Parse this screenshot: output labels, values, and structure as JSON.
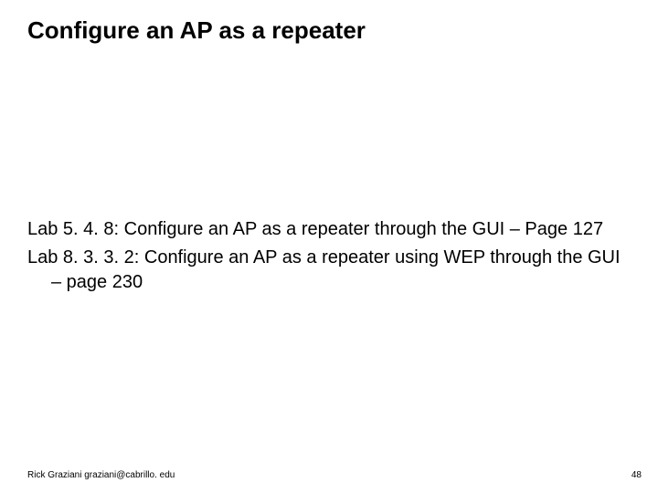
{
  "title": "Configure an AP as a repeater",
  "labs": [
    {
      "text": "Lab 5. 4. 8:  Configure an AP as a repeater through the GUI – Page 127"
    },
    {
      "text": "Lab 8. 3. 3. 2:  Configure an AP as a repeater using WEP through the GUI – page 230"
    }
  ],
  "footer": {
    "author": "Rick Graziani  graziani@cabrillo. edu",
    "page": "48"
  }
}
